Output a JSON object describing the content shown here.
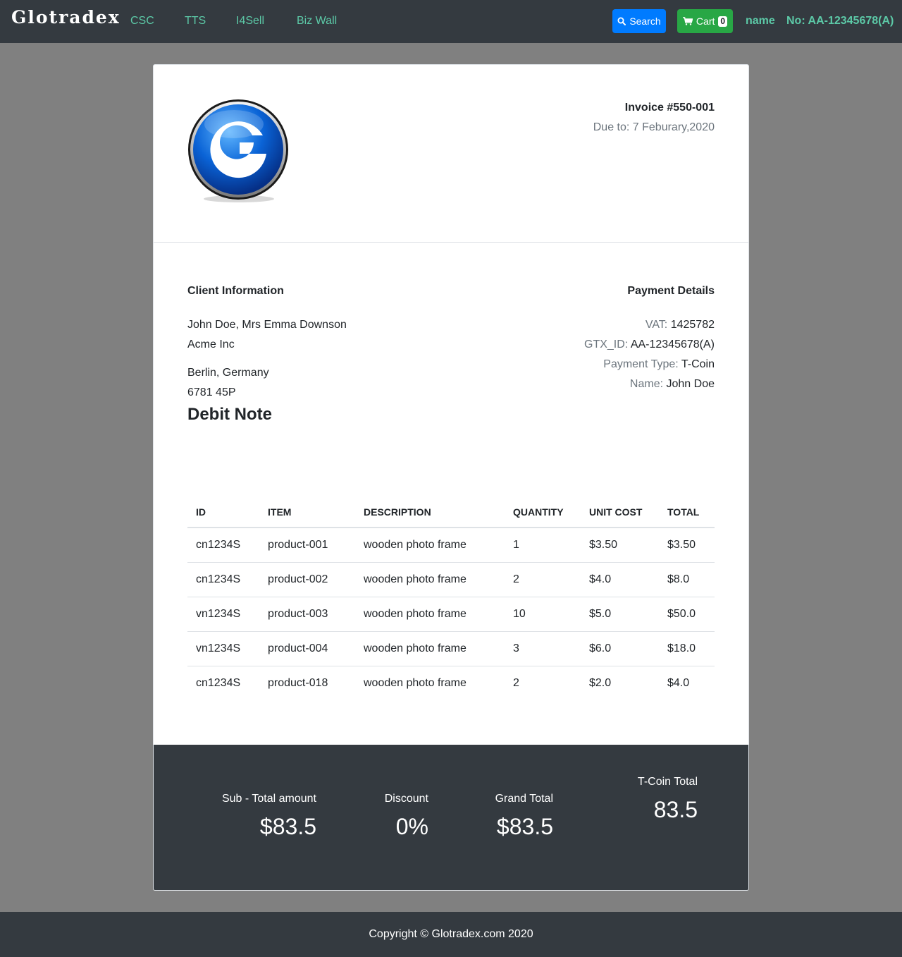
{
  "nav": {
    "brand": "Glotradex",
    "links": [
      "CSC",
      "TTS",
      "I4Sell",
      "Biz Wall"
    ],
    "search_label": "Search",
    "cart_label": "Cart",
    "cart_count": "0",
    "user_name": "name",
    "account_no": "No: AA-12345678(A)",
    "colors": {
      "bar": "#343a40",
      "link": "#5cc9a7",
      "search": "#007bff",
      "cart": "#28a745"
    }
  },
  "invoice": {
    "logo_icon": "glotradex-g-logo",
    "title": "Invoice #550-001",
    "due": "Due to: 7 Feburary,2020"
  },
  "client": {
    "heading": "Client Information",
    "lines": [
      "John Doe, Mrs Emma Downson",
      "Acme Inc",
      "Berlin, Germany",
      "6781 45P"
    ]
  },
  "payment": {
    "heading": "Payment Details",
    "rows": [
      {
        "label": "VAT:",
        "value": "1425782"
      },
      {
        "label": "GTX_ID:",
        "value": "AA-12345678(A)"
      },
      {
        "label": "Payment Type:",
        "value": "T-Coin"
      },
      {
        "label": "Name:",
        "value": "John Doe"
      }
    ]
  },
  "doc_type": "Debit Note",
  "table": {
    "headers": [
      "ID",
      "ITEM",
      "DESCRIPTION",
      "QUANTITY",
      "UNIT COST",
      "TOTAL"
    ],
    "rows": [
      [
        "cn1234S",
        "product-001",
        "wooden photo frame",
        "1",
        "$3.50",
        "$3.50"
      ],
      [
        "cn1234S",
        "product-002",
        "wooden photo frame",
        "2",
        "$4.0",
        "$8.0"
      ],
      [
        "vn1234S",
        "product-003",
        "wooden photo frame",
        "10",
        "$5.0",
        "$50.0"
      ],
      [
        "vn1234S",
        "product-004",
        "wooden photo frame",
        "3",
        "$6.0",
        "$18.0"
      ],
      [
        "cn1234S",
        "product-018",
        "wooden photo frame",
        "2",
        "$2.0",
        "$4.0"
      ]
    ]
  },
  "summary": {
    "subtotal_label": "Sub - Total amount",
    "subtotal_value": "$83.5",
    "discount_label": "Discount",
    "discount_value": "0%",
    "grand_label": "Grand Total",
    "grand_value": "$83.5",
    "tcoin_label": "T-Coin Total",
    "tcoin_value": "83.5"
  },
  "footer": {
    "copyright": "Copyright © Glotradex.com 2020"
  }
}
